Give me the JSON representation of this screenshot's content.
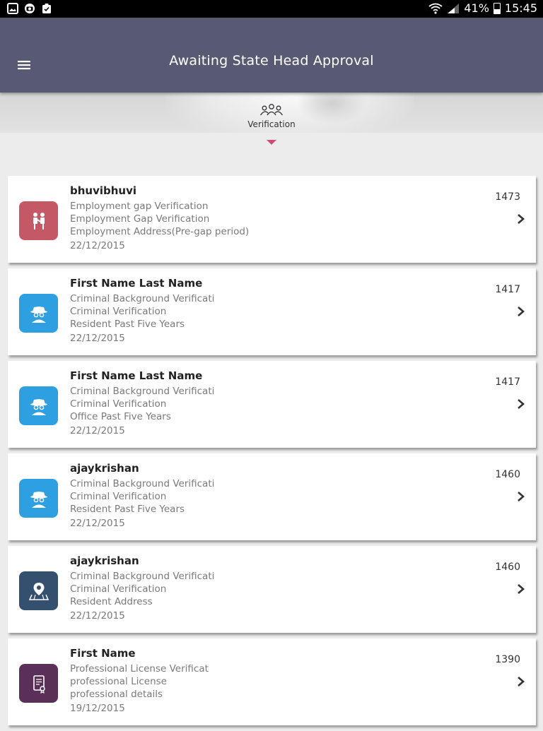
{
  "status_bar": {
    "battery": "41%",
    "time": "15:45",
    "left_icons": [
      "gallery-icon",
      "camera-icon",
      "clipboard-icon"
    ],
    "right_icons": [
      "wifi-icon",
      "signal-icon",
      "battery-icon"
    ]
  },
  "app_bar": {
    "title": "Awaiting State Head Approval",
    "menu_icon": "hamburger-menu-icon",
    "color": "#585a73"
  },
  "tabs": [
    {
      "label": "Verification",
      "icon": "people-group-icon",
      "selected": true
    }
  ],
  "accent_color": "#d24a77",
  "cases": [
    {
      "name": "bhuvibhuvi",
      "line1": "Employment gap Verification",
      "line2": "Employment Gap Verification",
      "line3": "Employment Address(Pre-gap period)",
      "date": "22/12/2015",
      "id": "1473",
      "icon": "employment-gap-icon",
      "icon_color": "#c45864"
    },
    {
      "name": "First Name Last Name",
      "line1": "Criminal Background Verificati",
      "line2": "Criminal Verification",
      "line3": "Resident Past Five Years",
      "date": "22/12/2015",
      "id": "1417",
      "icon": "detective-icon",
      "icon_color": "#2e9fe0"
    },
    {
      "name": "First Name Last Name",
      "line1": "Criminal Background Verificati",
      "line2": "Criminal Verification",
      "line3": "Office Past Five Years",
      "date": "22/12/2015",
      "id": "1417",
      "icon": "detective-icon",
      "icon_color": "#2e9fe0"
    },
    {
      "name": "ajaykrishan",
      "line1": "Criminal Background Verificati",
      "line2": "Criminal Verification",
      "line3": "Resident Past Five Years",
      "date": "22/12/2015",
      "id": "1460",
      "icon": "detective-icon",
      "icon_color": "#2e9fe0"
    },
    {
      "name": "ajaykrishan",
      "line1": "Criminal Background Verificati",
      "line2": "Criminal Verification",
      "line3": "Resident Address",
      "date": "22/12/2015",
      "id": "1460",
      "icon": "map-pin-icon",
      "icon_color": "#34506e"
    },
    {
      "name": "First Name",
      "line1": "Professional License Verificat",
      "line2": "professional License",
      "line3": "professional details",
      "date": "19/12/2015",
      "id": "1390",
      "icon": "certificate-icon",
      "icon_color": "#5a2f58"
    }
  ]
}
